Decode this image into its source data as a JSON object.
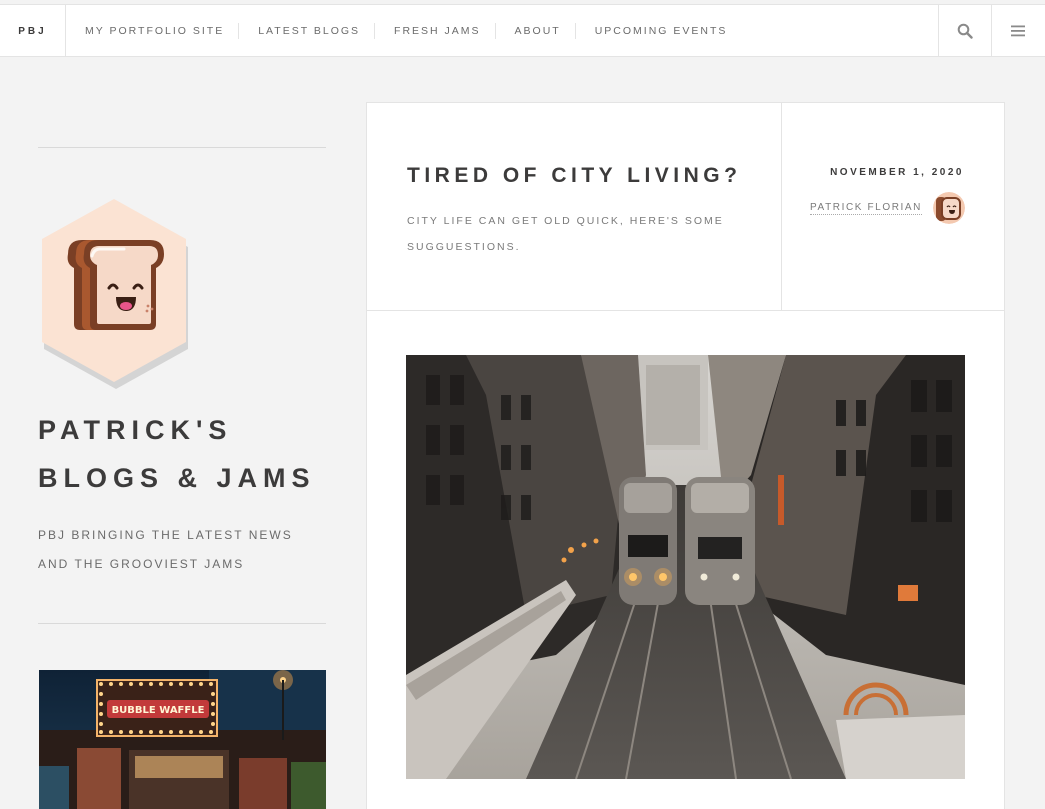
{
  "nav": {
    "brand": "PBJ",
    "links": [
      "MY PORTFOLIO SITE",
      "LATEST BLOGS",
      "FRESH JAMS",
      "ABOUT",
      "UPCOMING EVENTS"
    ],
    "search_icon": "search-icon",
    "menu_icon": "hamburger-menu-icon"
  },
  "sidebar": {
    "logo_icon": "toast-mascot-logo",
    "title_line1": "PATRICK'S",
    "title_line2": "BLOGS & JAMS",
    "description": "PBJ BRINGING THE LATEST NEWS AND THE GROOVIEST JAMS",
    "photo_sign": "BUBBLE WAFFLE"
  },
  "post": {
    "title": "TIRED OF CITY LIVING?",
    "excerpt": "CITY LIFE CAN GET OLD QUICK, HERE'S SOME SUGGUESTIONS.",
    "date": "NOVEMBER 1, 2020",
    "author": "PATRICK FLORIAN",
    "image": "elevated-train-city-photo"
  },
  "colors": {
    "background": "#f3f3f3",
    "card": "#ffffff",
    "text_dark": "#3c3b3b",
    "text_muted": "#7a7a7a",
    "border": "#e4e4e4",
    "logo_bg": "#fbe3d3",
    "toast_brown": "#7a3f25"
  }
}
